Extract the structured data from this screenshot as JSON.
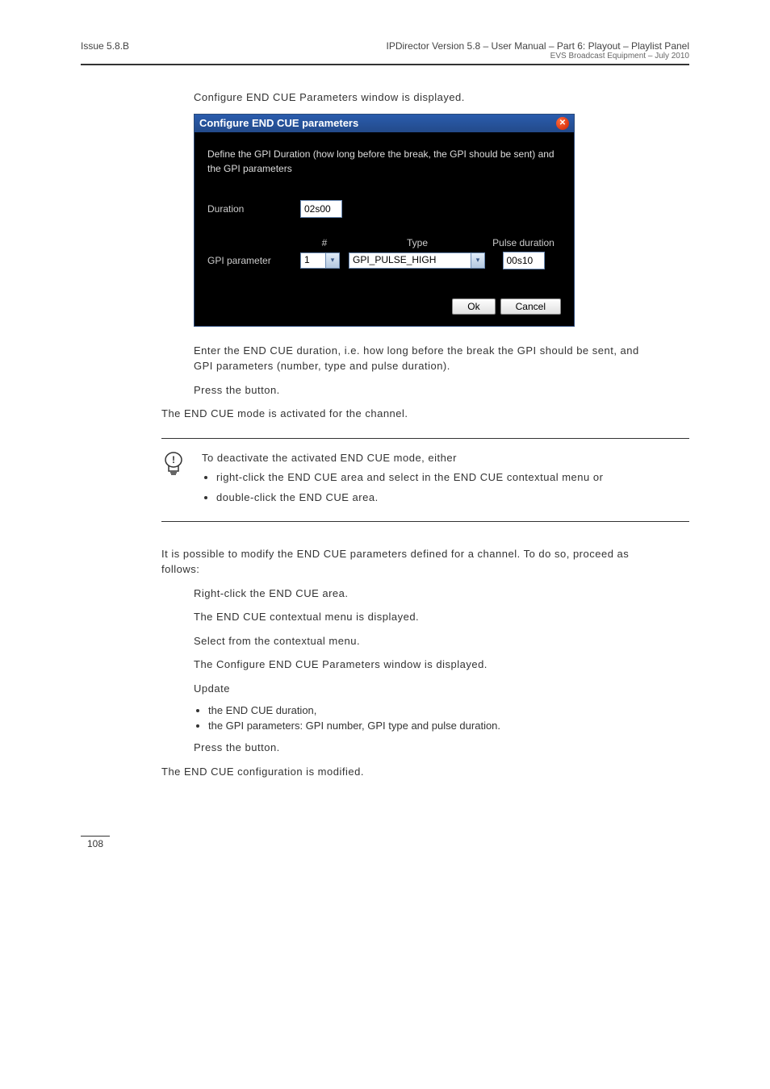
{
  "header": {
    "left": "Issue 5.8.B",
    "rightTop": "IPDirector Version 5.8 – User Manual – Part 6: Playout – Playlist Panel",
    "rightSub": "EVS Broadcast Equipment – July 2010"
  },
  "intro": {
    "line1": "Configure END CUE Parameters window is displayed."
  },
  "dialog": {
    "title": "Configure END CUE parameters",
    "desc": "Define the GPI Duration (how long before the break, the GPI should be sent) and the GPI parameters",
    "durationLabel": "Duration",
    "durationValue": "02s00",
    "cols": {
      "num": "#",
      "type": "Type",
      "pulse": "Pulse duration"
    },
    "gpiLabel": "GPI parameter",
    "gpiNum": "1",
    "gpiType": "GPI_PULSE_HIGH",
    "gpiPulse": "00s10",
    "okLabel": "Ok",
    "cancelLabel": "Cancel"
  },
  "afterDialog": {
    "p1": "Enter the END CUE duration, i.e. how long before the break the GPI should be sent, and GPI parameters (number, type and pulse duration).",
    "p2a": "Press the ",
    "p2b": " button."
  },
  "result1": "The END CUE mode is activated for the channel.",
  "note": {
    "intro": "To deactivate the activated END CUE mode, either",
    "b1a": "right-click the END CUE area and select ",
    "b1b": " in the END CUE contextual menu or",
    "b2": "double-click the END CUE area."
  },
  "modify": {
    "intro": "It is possible to modify the END CUE parameters defined for a channel. To do so, proceed as follows:",
    "s1": "Right-click the END CUE area.",
    "s1b": "The END CUE contextual menu is displayed.",
    "s2a": "Select ",
    "s2b": " from the contextual menu.",
    "s2c": "The Configure END CUE Parameters window is displayed.",
    "s3": "Update",
    "s3b1": "the END CUE duration,",
    "s3b2": "the GPI parameters: GPI number, GPI type and pulse duration.",
    "s4a": "Press the ",
    "s4b": " button."
  },
  "result2": "The END CUE configuration is modified.",
  "pageNumber": "108"
}
